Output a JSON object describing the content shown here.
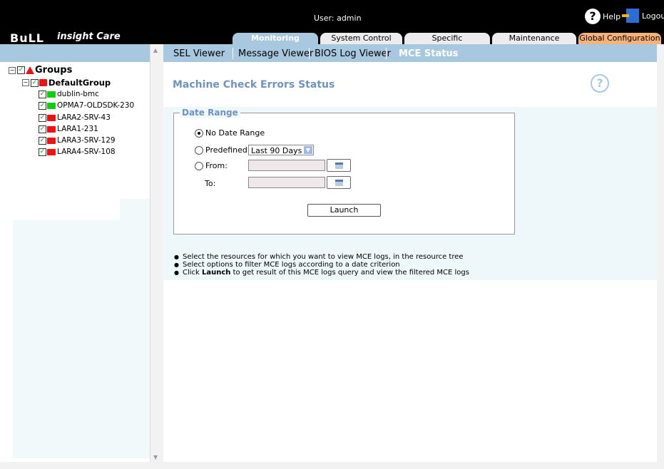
{
  "header": {
    "user_label": "User: admin",
    "logo_text": "BuLL",
    "brand": "insight Care",
    "help_label": "Help",
    "logout_label": "Logout"
  },
  "tabs": [
    {
      "label": "Monitoring",
      "active": true
    },
    {
      "label": "System Control"
    },
    {
      "label": "Specific Configuration"
    },
    {
      "label": "Maintenance"
    },
    {
      "label": "Global Configuration"
    }
  ],
  "subnav": [
    {
      "label": "SEL Viewer"
    },
    {
      "label": "Message Viewer"
    },
    {
      "label": "BIOS Log Viewer"
    },
    {
      "label": "MCE Status",
      "active": true
    }
  ],
  "tree": {
    "root_label": "Groups",
    "group_label": "DefaultGroup",
    "nodes": [
      {
        "label": "dublin-bmc",
        "status": "green"
      },
      {
        "label": "OPMA7-OLDSDK-230",
        "status": "green"
      },
      {
        "label": "LARA2-SRV-43",
        "status": "red"
      },
      {
        "label": "LARA1-231",
        "status": "red"
      },
      {
        "label": "LARA3-SRV-129",
        "status": "red"
      },
      {
        "label": "LARA4-SRV-108",
        "status": "red"
      }
    ]
  },
  "main": {
    "title": "Machine Check Errors Status",
    "legend": "Date Range",
    "no_date_range_label": "No Date Range",
    "predefined_label": "Predefined:",
    "predefined_value": "Last 90 Days",
    "from_label": "From:",
    "to_label": "To:",
    "from_value": "",
    "to_value": "",
    "launch_label": "Launch",
    "instructions": [
      "Select the resources for which you want to view MCE logs, in the resource tree",
      "Select options to filter MCE logs according to a date criterion"
    ],
    "instruction3_prefix": "Click ",
    "instruction3_bold": "Launch",
    "instruction3_suffix": " to get result of this MCE logs query and view the filtered MCE logs"
  },
  "colors": {
    "accent": "#a8c8e0",
    "title": "#6f93bf",
    "global_tab": "#f7b27a"
  }
}
